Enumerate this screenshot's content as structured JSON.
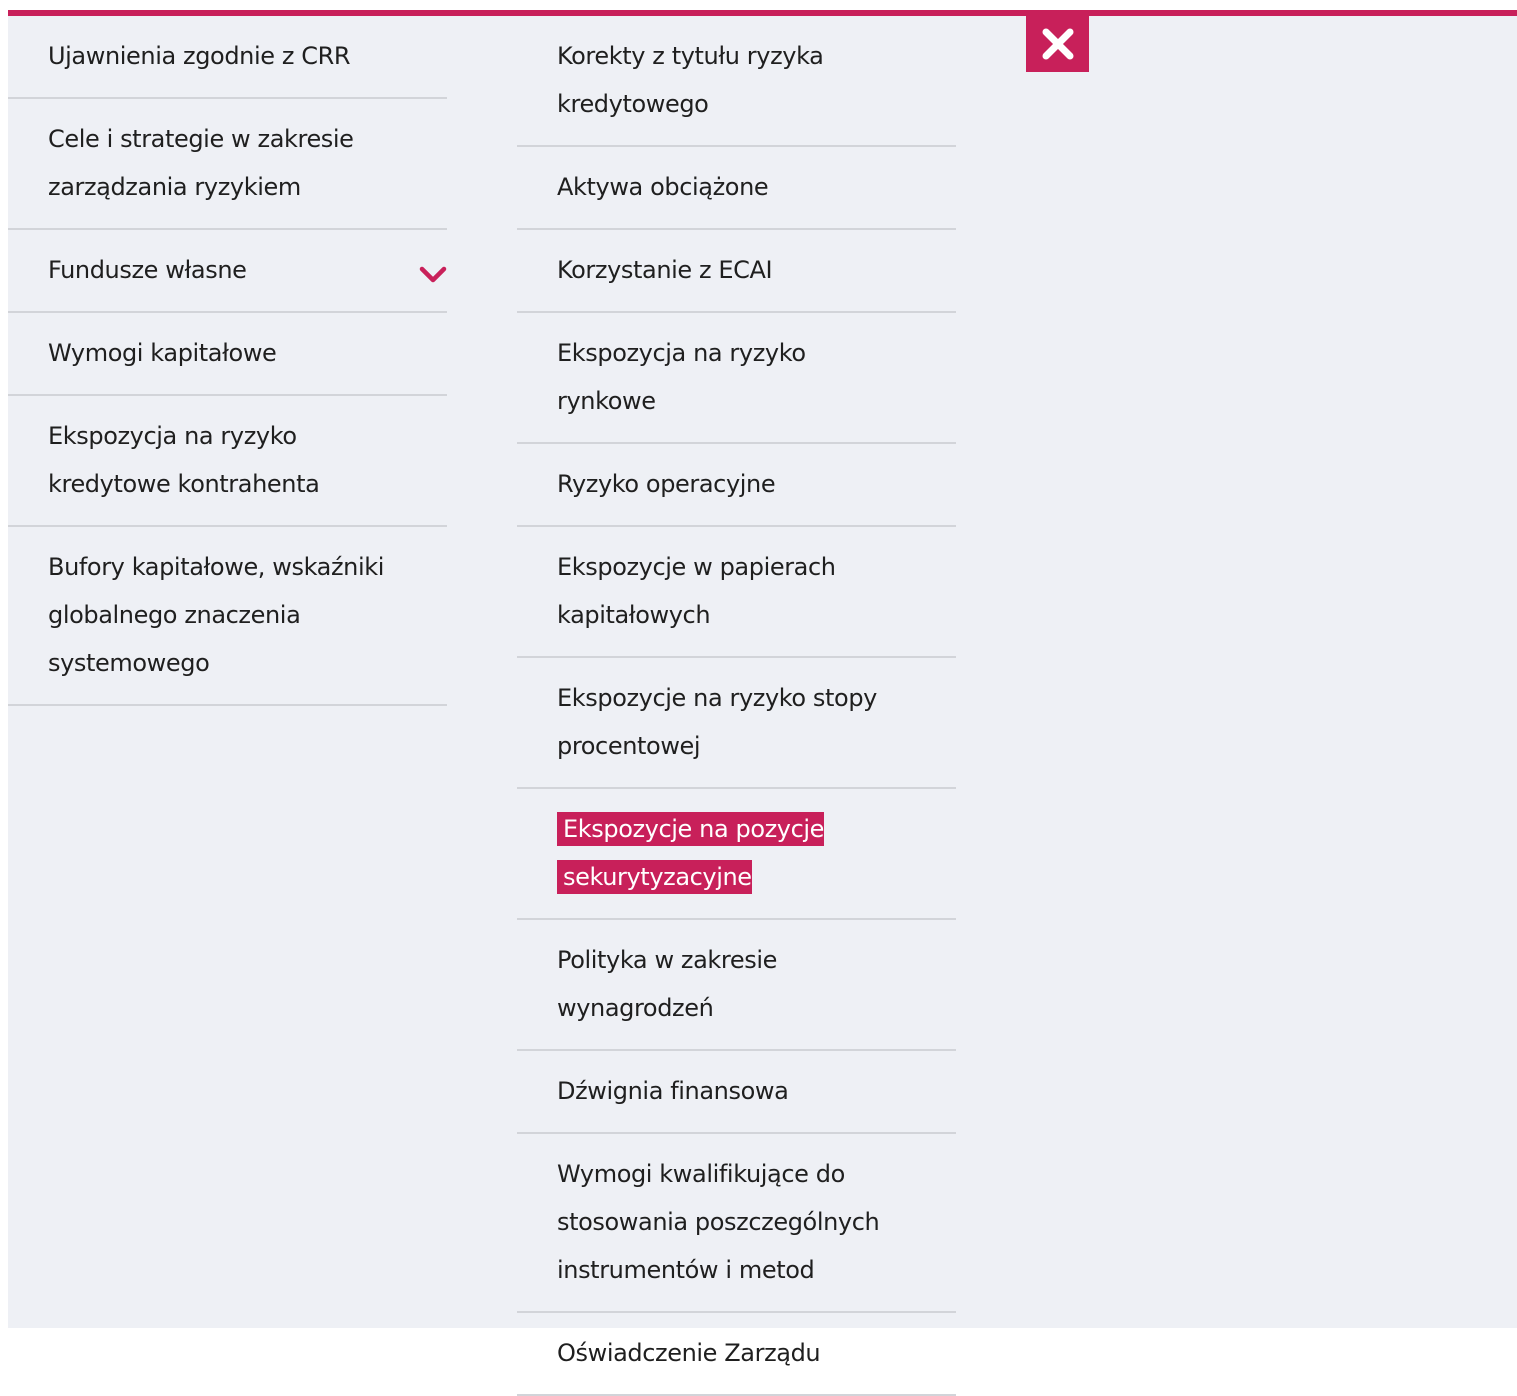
{
  "colors": {
    "accent": "#c8205a",
    "panel_bg": "#eef0f5",
    "divider": "#d2d4d9",
    "text": "#1f1f1f"
  },
  "left_menu": [
    {
      "label": "Ujawnienia zgodnie z CRR"
    },
    {
      "label": "Cele i strategie w zakresie zarządzania ryzykiem"
    },
    {
      "label": "Fundusze własne",
      "has_submenu": true,
      "icon": "chevron-down-icon"
    },
    {
      "label": "Wymogi kapitałowe"
    },
    {
      "label": "Ekspozycja na ryzyko kredytowe kontrahenta"
    },
    {
      "label": "Bufory kapitałowe, wskaźniki globalnego znaczenia systemowego"
    }
  ],
  "right_menu": [
    {
      "label": "Korekty z tytułu ryzyka kredytowego"
    },
    {
      "label": "Aktywa obciążone"
    },
    {
      "label": "Korzystanie z ECAI"
    },
    {
      "label": "Ekspozycja na ryzyko rynkowe"
    },
    {
      "label": "Ryzyko operacyjne"
    },
    {
      "label": "Ekspozycje w papierach kapitałowych"
    },
    {
      "label": "Ekspozycje na ryzyko stopy procentowej"
    },
    {
      "label": "Ekspozycje na pozycje sekurytyzacyjne",
      "active": true
    },
    {
      "label": "Polityka w zakresie wynagrodzeń"
    },
    {
      "label": "Dźwignia finansowa"
    },
    {
      "label": "Wymogi kwalifikujące do stosowania poszczególnych instrumentów i metod"
    },
    {
      "label": "Oświadczenie Zarządu"
    }
  ],
  "close_button": {
    "icon": "close-icon"
  }
}
